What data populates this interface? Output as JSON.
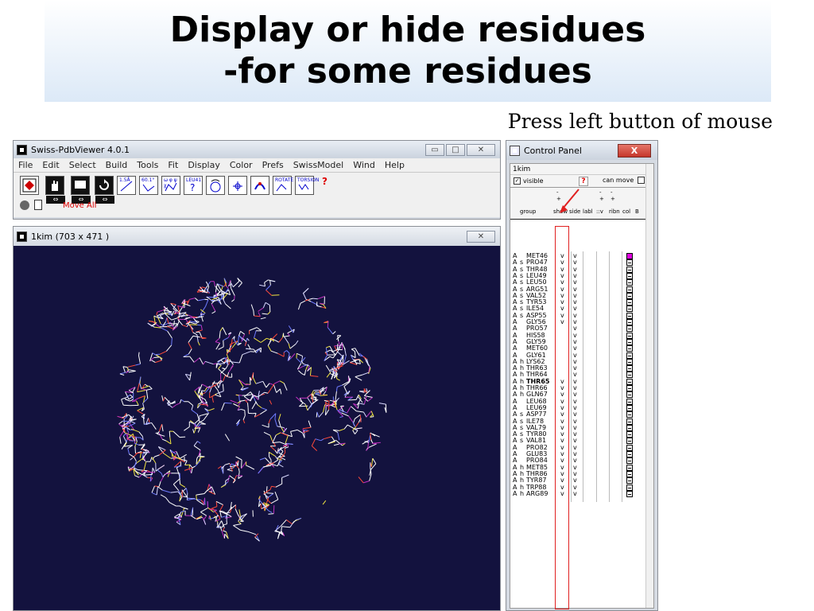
{
  "slide": {
    "title_line1": "Display or hide residues",
    "title_line2": "-for some residues",
    "caption": "Press left button of mouse"
  },
  "main_window": {
    "title": "Swiss-PdbViewer 4.0.1",
    "menu": [
      "File",
      "Edit",
      "Select",
      "Build",
      "Tools",
      "Fit",
      "Display",
      "Color",
      "Prefs",
      "SwissModel",
      "Wind",
      "Help"
    ],
    "toolbar_labels": [
      "1.5Å",
      "60.1°",
      "ω φ ψ χ",
      "LEU41",
      "ROTATE",
      "TORSION"
    ],
    "status": "Move All",
    "window_buttons": [
      "minimize",
      "maximize",
      "close"
    ]
  },
  "molecule_window": {
    "title": "1kim  (703 x 471 )",
    "background": "#13123e"
  },
  "control_panel": {
    "title": "Control Panel",
    "close_label": "X",
    "molecule": "1kim",
    "visible_label": "visible",
    "visible_checked": true,
    "help_label": "?",
    "can_move_label": "can move",
    "headers": {
      "group": "group",
      "show": "show",
      "side": "side",
      "labl": "labl",
      "v": "::v",
      "ribn": "ribn",
      "col": "col",
      "b": "B"
    },
    "header_markers": [
      "-",
      "+",
      "-",
      "+",
      "-",
      "+"
    ],
    "rows": [
      {
        "chain": "A",
        "ss": "",
        "res": "MET46",
        "show": "v",
        "side": "v",
        "col": "magenta"
      },
      {
        "chain": "A",
        "ss": "s",
        "res": "PRO47",
        "show": "v",
        "side": "v",
        "col": "box"
      },
      {
        "chain": "A",
        "ss": "s",
        "res": "THR48",
        "show": "v",
        "side": "v",
        "col": "box"
      },
      {
        "chain": "A",
        "ss": "s",
        "res": "LEU49",
        "show": "v",
        "side": "v",
        "col": "box"
      },
      {
        "chain": "A",
        "ss": "s",
        "res": "LEU50",
        "show": "v",
        "side": "v",
        "col": "box"
      },
      {
        "chain": "A",
        "ss": "s",
        "res": "ARG51",
        "show": "v",
        "side": "v",
        "col": "box"
      },
      {
        "chain": "A",
        "ss": "s",
        "res": "VAL52",
        "show": "v",
        "side": "v",
        "col": "box"
      },
      {
        "chain": "A",
        "ss": "s",
        "res": "TYR53",
        "show": "v",
        "side": "v",
        "col": "box"
      },
      {
        "chain": "A",
        "ss": "s",
        "res": "ILE54",
        "show": "v",
        "side": "v",
        "col": "box"
      },
      {
        "chain": "A",
        "ss": "s",
        "res": "ASP55",
        "show": "v",
        "side": "v",
        "col": "box"
      },
      {
        "chain": "A",
        "ss": "",
        "res": "GLY56",
        "show": "v",
        "side": "v",
        "col": "box"
      },
      {
        "chain": "A",
        "ss": "",
        "res": "PRO57",
        "show": "",
        "side": "v",
        "col": "box"
      },
      {
        "chain": "A",
        "ss": "",
        "res": "HIS58",
        "show": "",
        "side": "v",
        "col": "box"
      },
      {
        "chain": "A",
        "ss": "",
        "res": "GLY59",
        "show": "",
        "side": "v",
        "col": "box"
      },
      {
        "chain": "A",
        "ss": "",
        "res": "MET60",
        "show": "",
        "side": "v",
        "col": "box"
      },
      {
        "chain": "A",
        "ss": "",
        "res": "GLY61",
        "show": "",
        "side": "v",
        "col": "box"
      },
      {
        "chain": "A",
        "ss": "h",
        "res": "LYS62",
        "show": "",
        "side": "v",
        "col": "box"
      },
      {
        "chain": "A",
        "ss": "h",
        "res": "THR63",
        "show": "",
        "side": "v",
        "col": "box"
      },
      {
        "chain": "A",
        "ss": "h",
        "res": "THR64",
        "show": "",
        "side": "v",
        "col": "box"
      },
      {
        "chain": "A",
        "ss": "h",
        "res": "THR65",
        "show": "v",
        "side": "v",
        "col": "box",
        "bold": true
      },
      {
        "chain": "A",
        "ss": "h",
        "res": "THR66",
        "show": "v",
        "side": "v",
        "col": "box"
      },
      {
        "chain": "A",
        "ss": "h",
        "res": "GLN67",
        "show": "v",
        "side": "v",
        "col": "box"
      },
      {
        "chain": "A",
        "ss": "",
        "res": "LEU68",
        "show": "v",
        "side": "v",
        "col": "box"
      },
      {
        "chain": "A",
        "ss": "",
        "res": "LEU69",
        "show": "v",
        "side": "v",
        "col": "box"
      },
      {
        "chain": "A",
        "ss": "s",
        "res": "ASP77",
        "show": "v",
        "side": "v",
        "col": "box"
      },
      {
        "chain": "A",
        "ss": "s",
        "res": "ILE78",
        "show": "v",
        "side": "v",
        "col": "box"
      },
      {
        "chain": "A",
        "ss": "s",
        "res": "VAL79",
        "show": "v",
        "side": "v",
        "col": "box"
      },
      {
        "chain": "A",
        "ss": "s",
        "res": "TYR80",
        "show": "v",
        "side": "v",
        "col": "box"
      },
      {
        "chain": "A",
        "ss": "s",
        "res": "VAL81",
        "show": "v",
        "side": "v",
        "col": "box"
      },
      {
        "chain": "A",
        "ss": "",
        "res": "PRO82",
        "show": "v",
        "side": "v",
        "col": "box"
      },
      {
        "chain": "A",
        "ss": "",
        "res": "GLU83",
        "show": "v",
        "side": "v",
        "col": "box"
      },
      {
        "chain": "A",
        "ss": "",
        "res": "PRO84",
        "show": "v",
        "side": "v",
        "col": "box"
      },
      {
        "chain": "A",
        "ss": "h",
        "res": "MET85",
        "show": "v",
        "side": "v",
        "col": "box"
      },
      {
        "chain": "A",
        "ss": "h",
        "res": "THR86",
        "show": "v",
        "side": "v",
        "col": "box"
      },
      {
        "chain": "A",
        "ss": "h",
        "res": "TYR87",
        "show": "v",
        "side": "v",
        "col": "box"
      },
      {
        "chain": "A",
        "ss": "h",
        "res": "TRP88",
        "show": "v",
        "side": "v",
        "col": "box"
      },
      {
        "chain": "A",
        "ss": "h",
        "res": "ARG89",
        "show": "v",
        "side": "v",
        "col": "box"
      }
    ]
  }
}
